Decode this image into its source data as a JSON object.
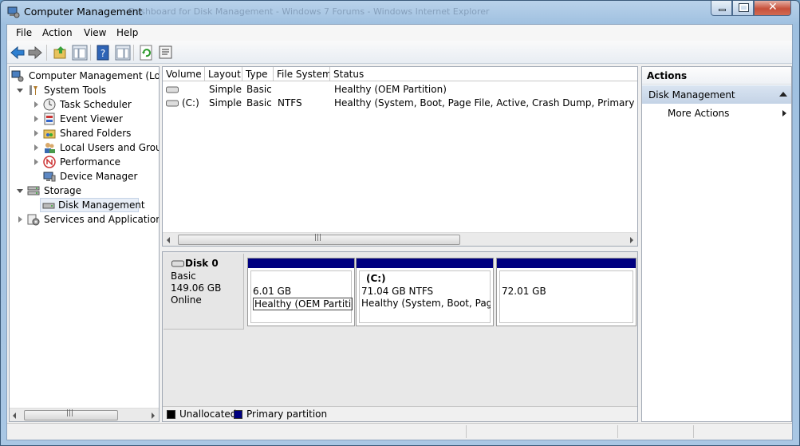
{
  "window": {
    "title": "Computer Management",
    "background_title": "Dashboard for Disk Management - Windows 7 Forums - Windows Internet Explorer"
  },
  "menu": [
    "File",
    "Action",
    "View",
    "Help"
  ],
  "toolbar": {
    "buttons": [
      "back-icon",
      "forward-icon",
      "up-folder-icon",
      "show-hide-tree-icon",
      "help-icon",
      "show-hide-action-pane-icon",
      "refresh-icon",
      "properties-icon"
    ]
  },
  "tree": {
    "root": "Computer Management (Local",
    "system_tools": "System Tools",
    "task_scheduler": "Task Scheduler",
    "event_viewer": "Event Viewer",
    "shared_folders": "Shared Folders",
    "local_users": "Local Users and Groups",
    "performance": "Performance",
    "device_manager": "Device Manager",
    "storage": "Storage",
    "disk_management": "Disk Management",
    "services": "Services and Applications"
  },
  "volumes": {
    "columns": [
      "Volume",
      "Layout",
      "Type",
      "File System",
      "Status"
    ],
    "rows": [
      {
        "volume": "",
        "layout": "Simple",
        "type": "Basic",
        "fs": "",
        "status": "Healthy (OEM Partition)"
      },
      {
        "volume": "(C:)",
        "layout": "Simple",
        "type": "Basic",
        "fs": "NTFS",
        "status": "Healthy (System, Boot, Page File, Active, Crash Dump, Primary Partition"
      }
    ]
  },
  "disk": {
    "name": "Disk 0",
    "type": "Basic",
    "size": "149.06 GB",
    "state": "Online",
    "partitions": [
      {
        "label": "",
        "size": "6.01 GB",
        "status": "Healthy (OEM Partition)",
        "kind": "primary"
      },
      {
        "label": "(C:)",
        "size": "71.04 GB NTFS",
        "status": "Healthy (System, Boot, Page F",
        "kind": "primary"
      },
      {
        "label": "",
        "size": "72.01 GB",
        "status": "",
        "kind": "primary"
      }
    ]
  },
  "legend": {
    "unallocated": "Unallocated",
    "primary": "Primary partition",
    "unallocated_color": "#000000",
    "primary_color": "#000080"
  },
  "actions": {
    "header": "Actions",
    "section": "Disk Management",
    "more": "More Actions"
  }
}
